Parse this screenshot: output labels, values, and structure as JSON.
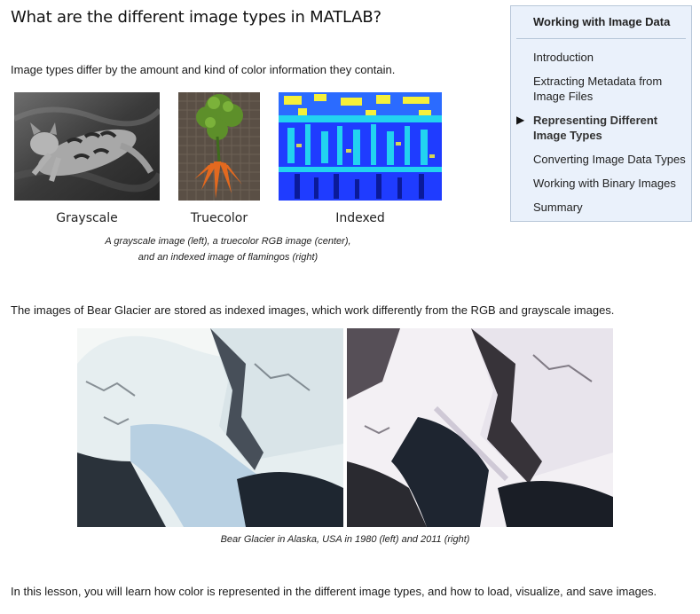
{
  "page": {
    "title": "What are the different image types in MATLAB?",
    "intro": "Image types differ by the amount and kind of color information they contain.",
    "glacier_text": "The images of Bear Glacier are stored as indexed images, which work differently from the RGB and grayscale images.",
    "closing": "In this lesson, you will learn how color is represented in the different image types, and how to load, visualize, and save images."
  },
  "examples": {
    "labels": [
      "Grayscale",
      "Truecolor",
      "Indexed"
    ],
    "caption_line1": "A grayscale image (left), a truecolor RGB image (center),",
    "caption_line2": "and an indexed image of flamingos (right)"
  },
  "glacier": {
    "caption": "Bear Glacier in Alaska, USA in 1980 (left) and 2011 (right)"
  },
  "sidebar": {
    "title": "Working with Image Data",
    "marker": "▶",
    "items": [
      {
        "label": "Introduction",
        "active": false
      },
      {
        "label": "Extracting Metadata from Image Files",
        "active": false
      },
      {
        "label": "Representing Different Image Types",
        "active": true
      },
      {
        "label": "Converting Image Data Types",
        "active": false
      },
      {
        "label": "Working with Binary Images",
        "active": false
      },
      {
        "label": "Summary",
        "active": false
      }
    ]
  },
  "colors": {
    "sidebar_bg": "#eaf1fb",
    "sidebar_border": "#b8c7d9",
    "indexed_blue": "#1f3cff",
    "indexed_cyan": "#22d3f0",
    "indexed_yellow": "#f5f03a"
  }
}
